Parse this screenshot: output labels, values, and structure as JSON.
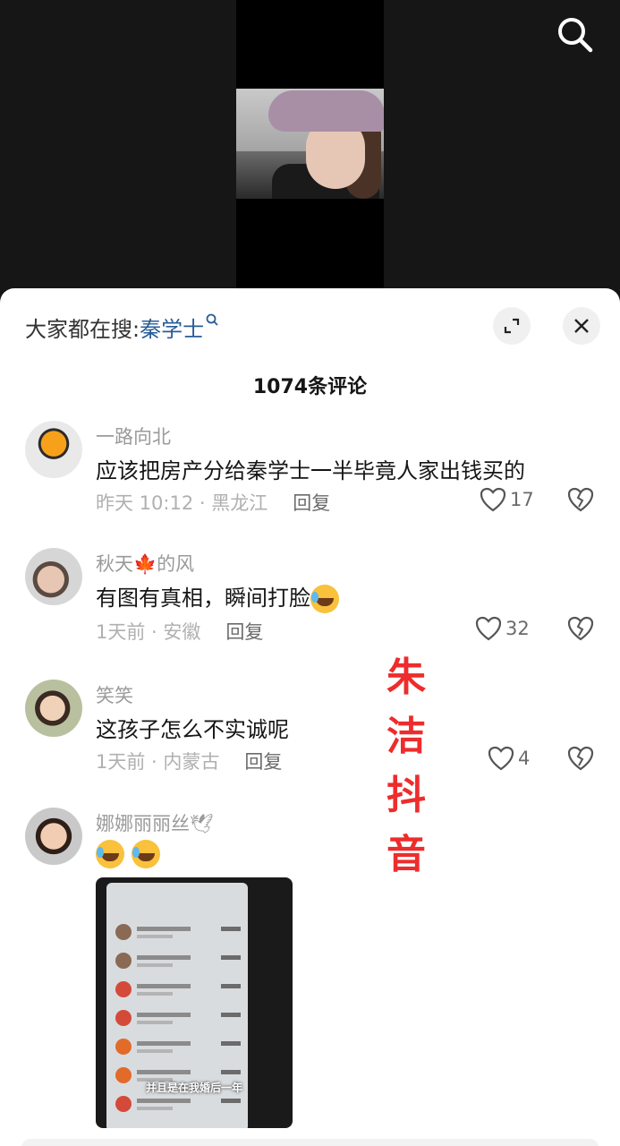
{
  "sheet": {
    "search_prefix": "大家都在搜:",
    "search_term": "秦学士",
    "count_title": "1074条评论"
  },
  "watermark": [
    "朱",
    "洁",
    "抖",
    "音"
  ],
  "comments": [
    {
      "username": "一路向北",
      "text": "应该把房产分给秦学士一半毕竟人家出钱买的",
      "meta": "昨天 10:12 · 黑龙江",
      "reply": "回复",
      "likes": "17"
    },
    {
      "username": "秋天",
      "username_suffix": "的风",
      "text": "有图有真相，瞬间打脸",
      "meta": "1天前 · 安徽",
      "reply": "回复",
      "likes": "32"
    },
    {
      "username": "笑笑",
      "text": "这孩子怎么不实诚呢",
      "meta": "1天前 · 内蒙古",
      "reply": "回复",
      "likes": "4"
    },
    {
      "username": "娜娜丽丽丝",
      "text": "",
      "image_caption": "并且是在我婚后一年"
    }
  ],
  "icons": {
    "search": "search-icon",
    "expand": "expand-icon",
    "close": "close-icon",
    "like": "heart-icon",
    "dislike": "broken-heart-icon"
  }
}
